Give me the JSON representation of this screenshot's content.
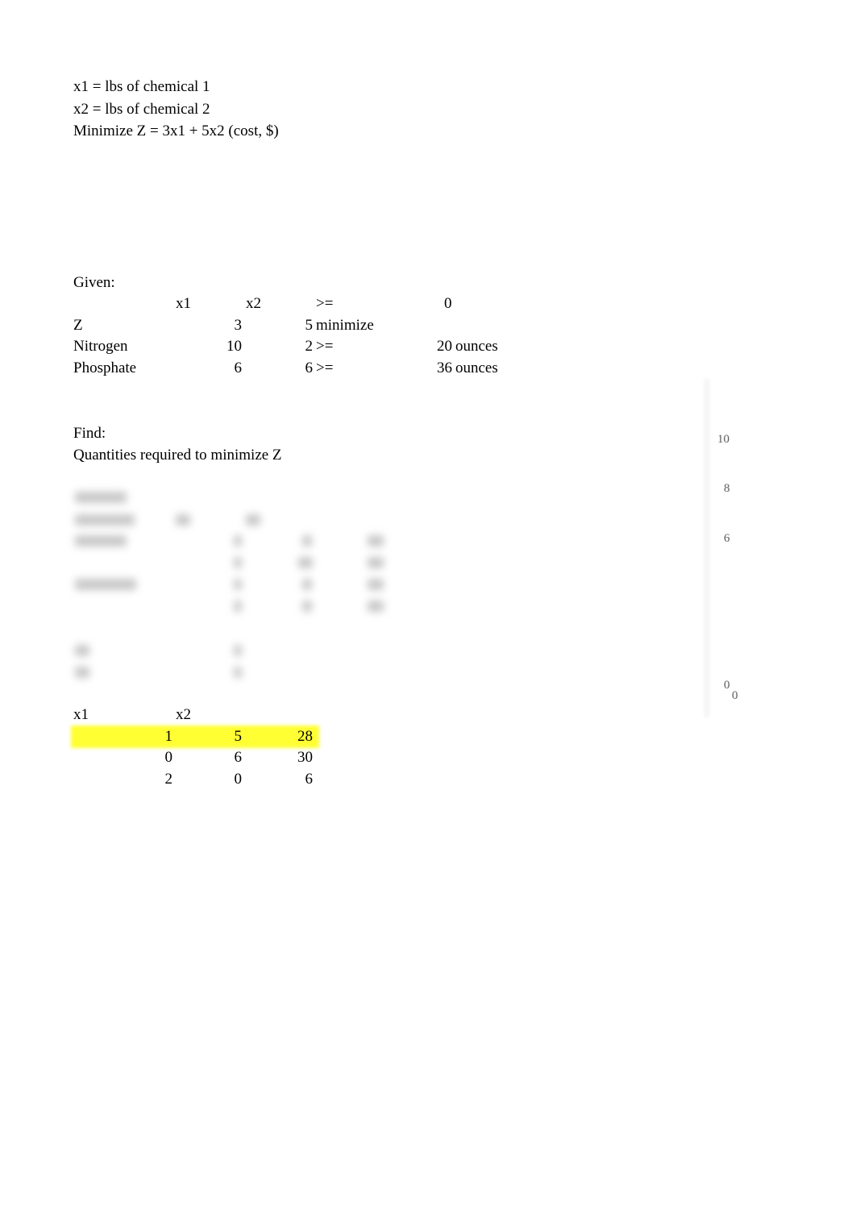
{
  "definitions": [
    "x1 = lbs of chemical 1",
    "x2 = lbs of chemical 2",
    "Minimize Z = 3x1 + 5x2 (cost, $)"
  ],
  "given": {
    "label": "Given:",
    "header": {
      "c1": "x1",
      "c2": "x2",
      "c3": ">=",
      "c4": "0"
    },
    "rows": [
      {
        "name": "Z",
        "x1": "3",
        "x2": "5",
        "op": "minimize",
        "rhs": "",
        "unit": ""
      },
      {
        "name": "Nitrogen",
        "x1": "10",
        "x2": "2",
        "op": ">=",
        "rhs": "20",
        "unit": "ounces"
      },
      {
        "name": "Phosphate",
        "x1": "6",
        "x2": "6",
        "op": ">=",
        "rhs": "36",
        "unit": "ounces"
      }
    ]
  },
  "find": {
    "label": "Find:",
    "text": "Quantities required to minimize Z"
  },
  "results": {
    "header": {
      "c1": "x1",
      "c2": "x2"
    },
    "rows": [
      {
        "x1": "1",
        "x2": "5",
        "z": "28",
        "highlighted": true
      },
      {
        "x1": "0",
        "x2": "6",
        "z": "30",
        "highlighted": false
      },
      {
        "x1": "2",
        "x2": "0",
        "z": "6",
        "highlighted": false
      }
    ],
    "highlight_color": "#ffff33"
  },
  "chart_axis_labels": [
    "10",
    "8",
    "6",
    "0",
    "0"
  ]
}
